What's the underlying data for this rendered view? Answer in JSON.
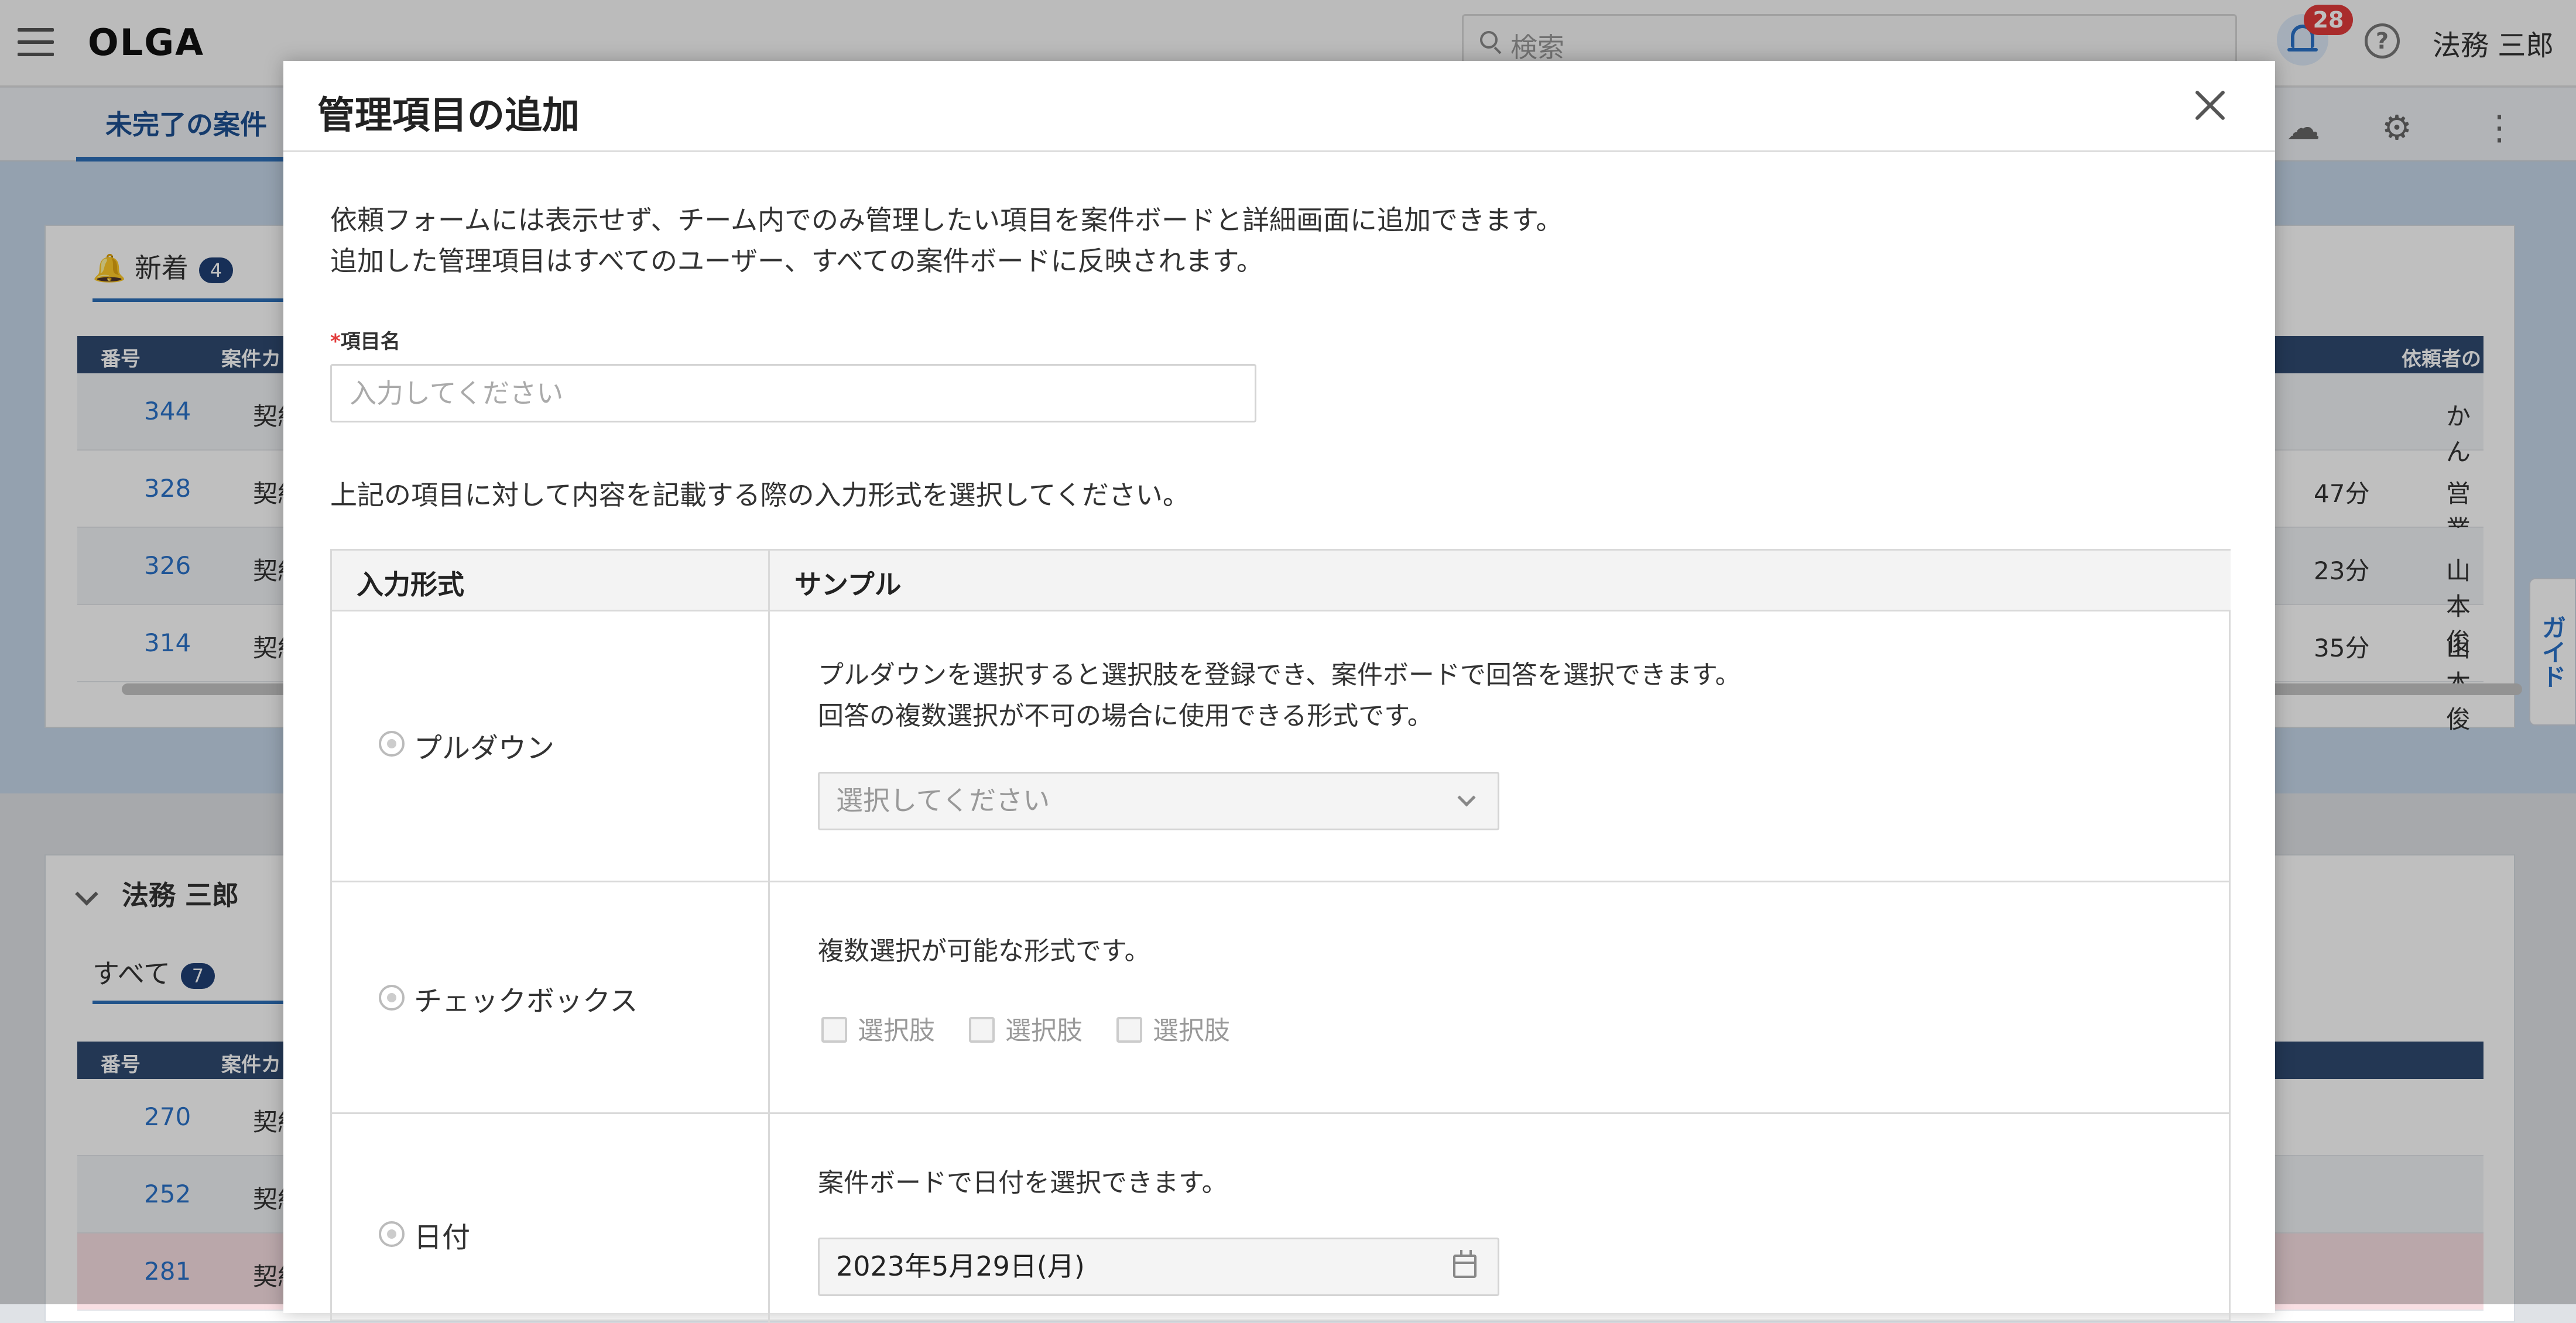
{
  "app": {
    "logo": "OLGA",
    "search_placeholder": "検索",
    "notifications_count": "28",
    "help_label": "?",
    "user_name": "法務 三郎"
  },
  "subnav": {
    "active_tab": "未完了の案件",
    "icons": [
      "cloud-download-icon",
      "gear-icon",
      "more-vertical-icon"
    ]
  },
  "panel_new": {
    "tab_label": "新着",
    "tab_count": "4",
    "headers": [
      "番号",
      "案件カ",
      "依頼者の"
    ],
    "rows": [
      {
        "num": "344",
        "cat": "契約書",
        "time": "",
        "requester": "かん"
      },
      {
        "num": "328",
        "cat": "契約書",
        "time": "47分",
        "requester": "営業一"
      },
      {
        "num": "326",
        "cat": "契約書",
        "time": "23分",
        "requester": "山本俊"
      },
      {
        "num": "314",
        "cat": "契約書",
        "time": "35分",
        "requester": "山本俊"
      }
    ]
  },
  "panel_user": {
    "title": "法務 三郎",
    "tab_label": "すべて",
    "tab_count": "7",
    "headers": [
      "番号",
      "案件カ"
    ],
    "rows": [
      {
        "num": "270",
        "cat": "契約書"
      },
      {
        "num": "252",
        "cat": "契約書"
      },
      {
        "num": "281",
        "cat": "契約書"
      }
    ]
  },
  "guide": "ガイド",
  "modal": {
    "title": "管理項目の追加",
    "desc_line1": "依頼フォームには表示せず、チーム内でのみ管理したい項目を案件ボードと詳細画面に追加できます。",
    "desc_line2": "追加した管理項目はすべてのユーザー、すべての案件ボードに反映されます。",
    "field_required_mark": "*",
    "field_label": "項目名",
    "field_placeholder": "入力してください",
    "instruction": "上記の項目に対して内容を記載する際の入力形式を選択してください。",
    "table_headers": {
      "format": "入力形式",
      "sample": "サンプル"
    },
    "formats": [
      {
        "label": "プルダウン",
        "desc1": "プルダウンを選択すると選択肢を登録でき、案件ボードで回答を選択できます。",
        "desc2": "回答の複数選択が不可の場合に使用できる形式です。",
        "select_placeholder": "選択してください"
      },
      {
        "label": "チェックボックス",
        "desc1": "複数選択が可能な形式です。",
        "options": [
          "選択肢",
          "選択肢",
          "選択肢"
        ]
      },
      {
        "label": "日付",
        "desc1": "案件ボードで日付を選択できます。",
        "date_value": "2023年5月29日(月)"
      }
    ]
  }
}
